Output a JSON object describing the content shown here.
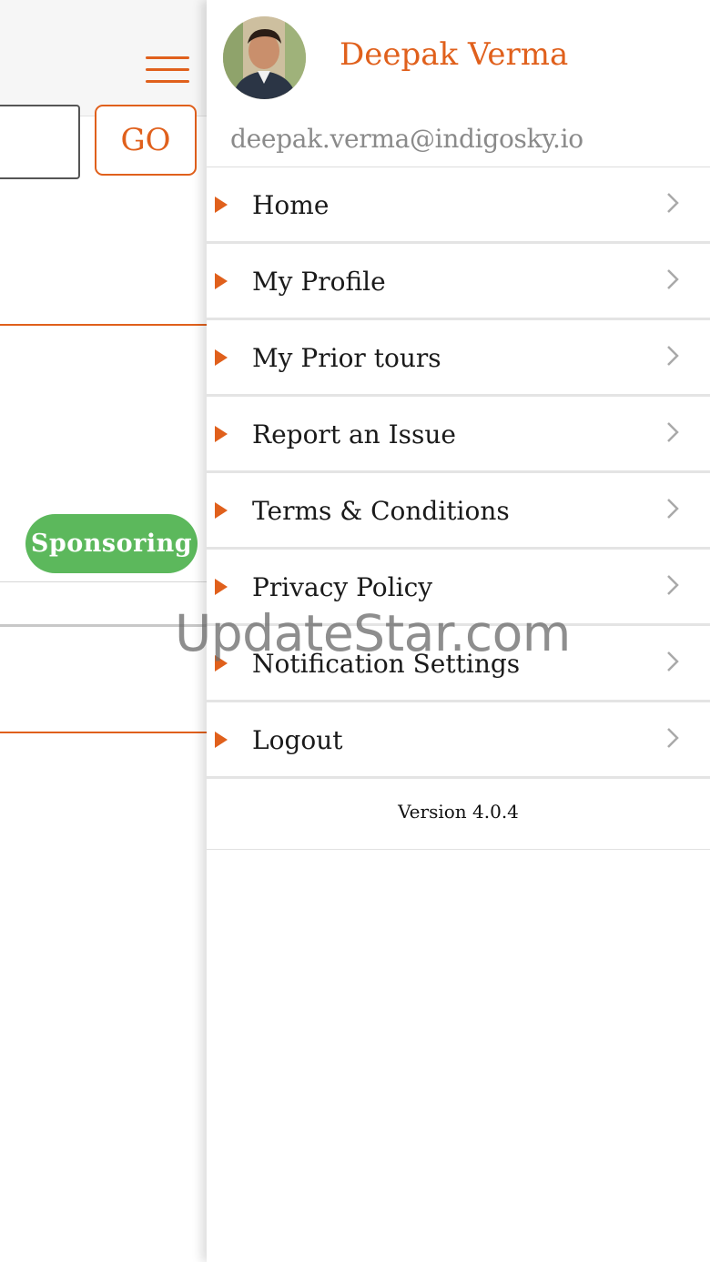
{
  "background_screen": {
    "go_button_label": "GO",
    "sponsoring_badge": "Sponsoring",
    "colors": {
      "accent": "#e0601c",
      "badge_green": "#5cb85c"
    },
    "icons": {
      "menu": "hamburger-menu-icon"
    }
  },
  "drawer": {
    "user": {
      "name": "Deepak Verma",
      "email": "deepak.verma@indigosky.io"
    },
    "menu_items": [
      {
        "label": "Home",
        "icon": "triangle-bullet-icon",
        "trailing_icon": "chevron-right-icon"
      },
      {
        "label": "My Profile",
        "icon": "triangle-bullet-icon",
        "trailing_icon": "chevron-right-icon"
      },
      {
        "label": "My Prior tours",
        "icon": "triangle-bullet-icon",
        "trailing_icon": "chevron-right-icon"
      },
      {
        "label": "Report an Issue",
        "icon": "triangle-bullet-icon",
        "trailing_icon": "chevron-right-icon"
      },
      {
        "label": "Terms & Conditions",
        "icon": "triangle-bullet-icon",
        "trailing_icon": "chevron-right-icon"
      },
      {
        "label": "Privacy Policy",
        "icon": "triangle-bullet-icon",
        "trailing_icon": "chevron-right-icon"
      },
      {
        "label": "Notification Settings",
        "icon": "triangle-bullet-icon",
        "trailing_icon": "chevron-right-icon"
      },
      {
        "label": "Logout",
        "icon": "triangle-bullet-icon",
        "trailing_icon": "chevron-right-icon"
      }
    ],
    "version": "Version 4.0.4"
  },
  "watermark": "UpdateStar.com"
}
